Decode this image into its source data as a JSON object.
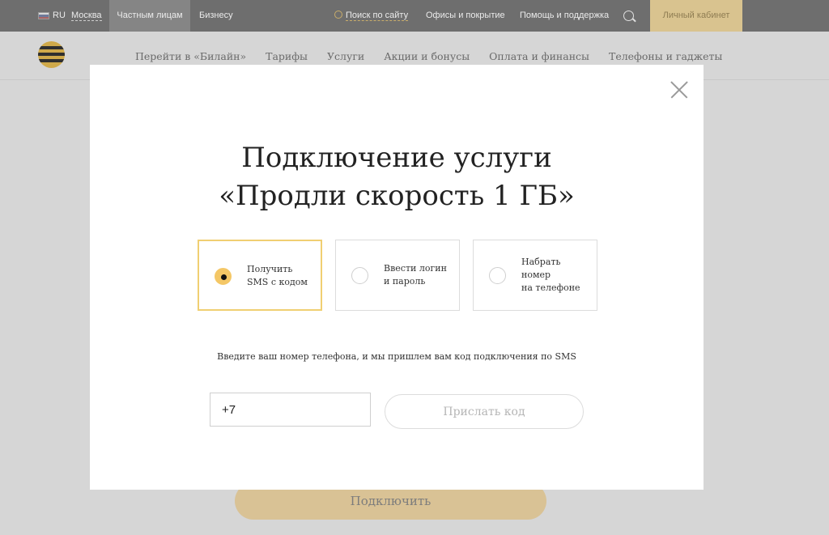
{
  "topbar": {
    "lang": "RU",
    "city": "Москва",
    "segments": {
      "private": "Частным лицам",
      "business": "Бизнесу"
    },
    "search": "Поиск по сайту",
    "offices": "Офисы и покрытие",
    "help": "Помощь и поддержка",
    "cabinet": "Личный кабинет"
  },
  "nav": {
    "items": [
      "Перейти в «Билайн»",
      "Тарифы",
      "Услуги",
      "Акции и бонусы",
      "Оплата и финансы",
      "Телефоны и гаджеты"
    ]
  },
  "page": {
    "connect_button": "Подключить"
  },
  "modal": {
    "title_line1": "Подключение услуги",
    "title_line2": "«Продли скорость 1 ГБ»",
    "options": [
      {
        "label": "Получить\nSMS с кодом",
        "selected": true
      },
      {
        "label": "Ввести логин\nи пароль",
        "selected": false
      },
      {
        "label": "Набрать\nномер\nна телефоне",
        "selected": false
      }
    ],
    "hint": "Введите ваш номер телефона, и мы пришлем вам код подключения по SMS",
    "phone_value": "+7",
    "send_button": "Прислать код"
  },
  "icons": [
    "flag-ru-icon",
    "search-icon",
    "beeline-logo",
    "close-icon",
    "radio-icon"
  ],
  "colors": {
    "accent": "#f4c766",
    "topbar": "#6e6e6e",
    "cabinet": "#d9c38f",
    "overlay_page": "#d6d6d6"
  }
}
